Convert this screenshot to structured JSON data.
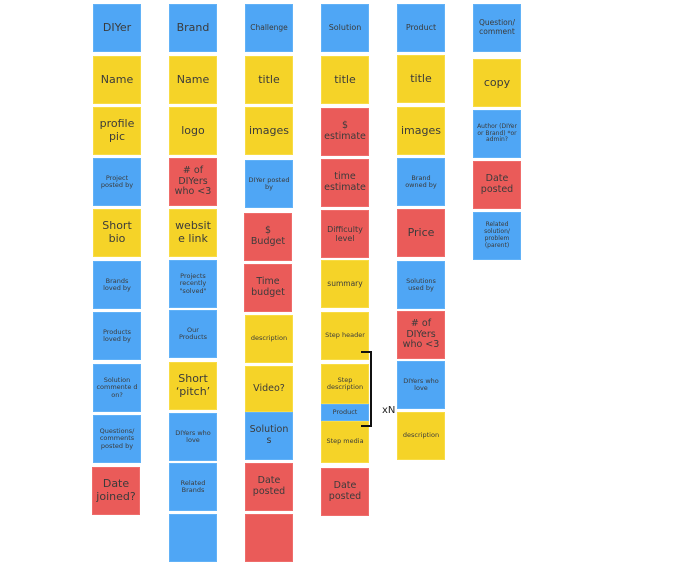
{
  "colors": {
    "blue": "#4fa6f5",
    "yellow": "#f5d328",
    "red": "#ea5b59"
  },
  "columns": [
    {
      "name": "DIYer",
      "notes": [
        {
          "text": "DIYer",
          "color": "blue"
        },
        {
          "text": "Name",
          "color": "yellow"
        },
        {
          "text": "profile pic",
          "color": "yellow"
        },
        {
          "text": "Project posted by",
          "color": "blue"
        },
        {
          "text": "Short bio",
          "color": "yellow"
        },
        {
          "text": "Brands loved by",
          "color": "blue"
        },
        {
          "text": "Products loved by",
          "color": "blue"
        },
        {
          "text": "Solution commente d on?",
          "color": "blue"
        },
        {
          "text": "Questions/ comments posted by",
          "color": "blue"
        },
        {
          "text": "Date joined?",
          "color": "red"
        }
      ]
    },
    {
      "name": "Brand",
      "notes": [
        {
          "text": "Brand",
          "color": "blue"
        },
        {
          "text": "Name",
          "color": "yellow"
        },
        {
          "text": "logo",
          "color": "yellow"
        },
        {
          "text": "# of DIYers who <3",
          "color": "red"
        },
        {
          "text": "website link",
          "color": "yellow"
        },
        {
          "text": "Projects recently \"solved\"",
          "color": "blue"
        },
        {
          "text": "Our Products",
          "color": "blue"
        },
        {
          "text": "Short ‘pitch’",
          "color": "yellow"
        },
        {
          "text": "DIYers who love",
          "color": "blue"
        },
        {
          "text": "Related Brands",
          "color": "blue"
        },
        {
          "text": "",
          "color": "blue"
        }
      ]
    },
    {
      "name": "Challenge",
      "notes": [
        {
          "text": "Challenge",
          "color": "blue"
        },
        {
          "text": "title",
          "color": "yellow"
        },
        {
          "text": "images",
          "color": "yellow"
        },
        {
          "text": "DIYer posted by",
          "color": "blue"
        },
        {
          "text": "$ Budget",
          "color": "red"
        },
        {
          "text": "Time budget",
          "color": "red"
        },
        {
          "text": "description",
          "color": "yellow"
        },
        {
          "text": "Video?",
          "color": "yellow"
        },
        {
          "text": "Solutions",
          "color": "blue"
        },
        {
          "text": "Date posted",
          "color": "red"
        },
        {
          "text": "",
          "color": "red"
        }
      ]
    },
    {
      "name": "Solution",
      "notes": [
        {
          "text": "Solution",
          "color": "blue"
        },
        {
          "text": "title",
          "color": "yellow"
        },
        {
          "text": "$ estimate",
          "color": "red"
        },
        {
          "text": "time estimate",
          "color": "red"
        },
        {
          "text": "Difficulty level",
          "color": "red"
        },
        {
          "text": "summary",
          "color": "yellow"
        },
        {
          "text": "Step header",
          "color": "yellow"
        },
        {
          "text": "Step description",
          "color": "yellow"
        },
        {
          "text": "Product",
          "color": "blue"
        },
        {
          "text": "Step media",
          "color": "yellow"
        },
        {
          "text": "Date posted",
          "color": "red"
        }
      ]
    },
    {
      "name": "Product",
      "notes": [
        {
          "text": "Product",
          "color": "blue"
        },
        {
          "text": "title",
          "color": "yellow"
        },
        {
          "text": "images",
          "color": "yellow"
        },
        {
          "text": "Brand owned by",
          "color": "blue"
        },
        {
          "text": "Price",
          "color": "red"
        },
        {
          "text": "Solutions used by",
          "color": "blue"
        },
        {
          "text": "# of DIYers who <3",
          "color": "red"
        },
        {
          "text": "DIYers who love",
          "color": "blue"
        },
        {
          "text": "description",
          "color": "yellow"
        }
      ]
    },
    {
      "name": "Question/comment",
      "notes": [
        {
          "text": "Question/ comment",
          "color": "blue"
        },
        {
          "text": "copy",
          "color": "yellow"
        },
        {
          "text": "Author (DIYer or Brand) *or admin?",
          "color": "blue"
        },
        {
          "text": "Date posted",
          "color": "red"
        },
        {
          "text": "Related solution/ problem (parent)",
          "color": "blue"
        }
      ]
    }
  ],
  "repeat_label": "xN"
}
